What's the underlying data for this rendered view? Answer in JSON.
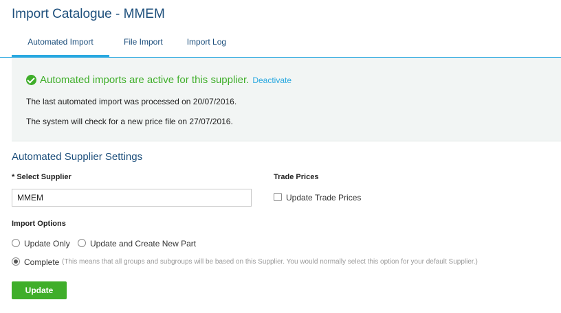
{
  "page": {
    "title": "Import Catalogue - MMEM"
  },
  "tabs": [
    {
      "label": "Automated Import",
      "active": true
    },
    {
      "label": "File Import",
      "active": false
    },
    {
      "label": "Import Log",
      "active": false
    }
  ],
  "status": {
    "icon": "check-circle-icon",
    "message": "Automated imports are active for this supplier.",
    "deactivate_label": "Deactivate",
    "last_import": "The last automated import was processed on 20/07/2016.",
    "next_check": "The system will check for a new price file on 27/07/2016."
  },
  "settings": {
    "title": "Automated Supplier Settings",
    "supplier_label": "* Select Supplier",
    "supplier_value": "MMEM",
    "trade_prices_label": "Trade Prices",
    "update_trade_prices_label": "Update Trade Prices",
    "update_trade_prices_checked": false,
    "import_options_label": "Import Options",
    "options": {
      "update_only": "Update Only",
      "update_and_create": "Update and Create New Part",
      "complete": "Complete",
      "complete_note": "(This means that all groups and subgroups will be based on this Supplier. You would normally select this option for your default Supplier.)"
    },
    "selected_option": "complete",
    "update_button_label": "Update"
  },
  "colors": {
    "title_blue": "#1d4f7c",
    "accent_blue": "#29a8e0",
    "success_green": "#3fae2a",
    "panel_bg": "#f2f5f4"
  }
}
